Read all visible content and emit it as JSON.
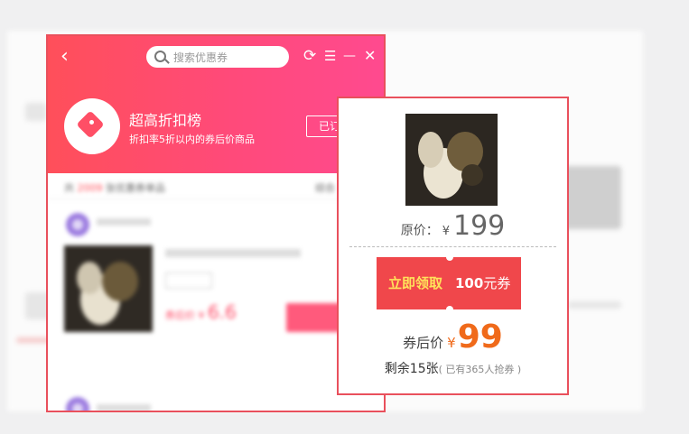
{
  "header": {
    "back_icon": "‹",
    "search_placeholder": "搜索优惠券",
    "refresh_icon": "⟳",
    "menu_icon": "☰",
    "minimize_icon": "—",
    "close_icon": "✕"
  },
  "hero": {
    "title": "超高折扣榜",
    "subtitle": "折扣率5折以内的券后价商品",
    "subscribe_label": "已订"
  },
  "list": {
    "count_prefix": "共",
    "count": "2009",
    "count_suffix": "张优惠券单品",
    "right_link": "综合",
    "item_price": "6.6"
  },
  "card": {
    "original_label": "原价：",
    "currency": "¥",
    "original_price": "199",
    "claim_label": "立即领取",
    "coupon_amount": "100",
    "coupon_unit": "元券",
    "after_label": "券后价",
    "after_price": "99",
    "remaining": "剩余15张",
    "grabbed": "( 已有365人抢券 )"
  },
  "colors": {
    "accent": "#ff4f5a",
    "border": "#e9505c",
    "price": "#f06a1a",
    "claim_text": "#ffe25a"
  }
}
